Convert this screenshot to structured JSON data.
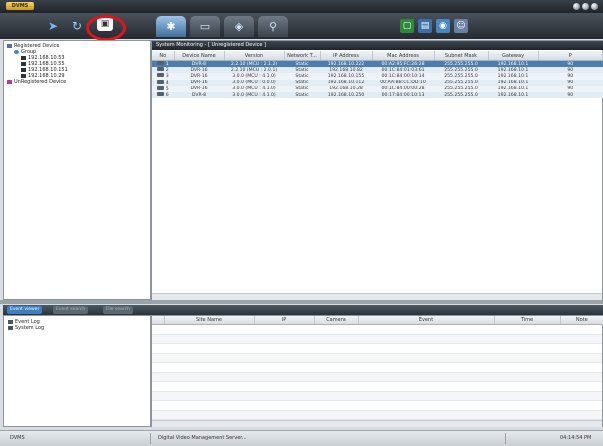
{
  "app": {
    "logo_text": "DVMS"
  },
  "tree": {
    "root_label": "Registered Device",
    "group_label": "Group",
    "devices": [
      "192.168.10.53",
      "192.168.10.55",
      "192.168.10.151",
      "192.168.10.29"
    ],
    "unregistered_label": "UnRegistered Device"
  },
  "panel_title": "System Monitoring - [ Unregistered Device ]",
  "table": {
    "headers": [
      "No",
      "Device Name",
      "Version",
      "Network T...",
      "IP Address",
      "Mac Address",
      "Subnet Mask",
      "Gateway",
      "P"
    ],
    "rows": [
      [
        "1",
        "DVR-8",
        "2.2.10 (MCU : 2.1.2)",
        "Static",
        "192.168.10.222",
        "00:A2:95:FC:26:28",
        "255.255.255.0",
        "192.168.10.1",
        "90"
      ],
      [
        "2",
        "DVR-16",
        "2.2.10 (MCU : 2.0.1)",
        "Static",
        "192.168.10.82",
        "00:1C:84:01:03:61",
        "255.255.255.0",
        "192.168.10.1",
        "90"
      ],
      [
        "3",
        "DVR-16",
        "3.0.0 (MCU : 4.1.0)",
        "Static",
        "192.168.10.155",
        "00:1C:84:00:10:14",
        "255.255.255.0",
        "192.168.10.1",
        "90"
      ],
      [
        "4",
        "DVR-16",
        "3.0.0 (MCU : 0.0.0)",
        "Static",
        "192.168.10.112",
        "00:AA:BB:CC:DD:10",
        "255.255.255.0",
        "192.168.10.1",
        "90"
      ],
      [
        "5",
        "DVR-16",
        "3.0.0 (MCU : 4.1.0)",
        "Static",
        "192.168.10.28",
        "00:1C:84:00:00:28",
        "255.255.255.0",
        "192.168.10.1",
        "90"
      ],
      [
        "6",
        "DVR-8",
        "3.0.0 (MCU : 4.1.0)",
        "Static",
        "192.168.10.250",
        "00:17:84:00:10:13",
        "255.255.255.0",
        "192.168.10.1",
        "90"
      ]
    ]
  },
  "bottom": {
    "tabs": [
      "Event viewer",
      "Event search",
      "File search"
    ],
    "tree_items": [
      "Event Log",
      "System Log"
    ],
    "event_headers": [
      "",
      "Site Name",
      "IP",
      "Camera",
      "Event",
      "Time",
      "Note"
    ]
  },
  "statusbar": {
    "left": "DVMS",
    "middle": "Digital Video Management Server...",
    "time": "04:14:54 PM"
  },
  "colors": {
    "highlight": "#e0141a",
    "selection": "#4c7db1"
  }
}
